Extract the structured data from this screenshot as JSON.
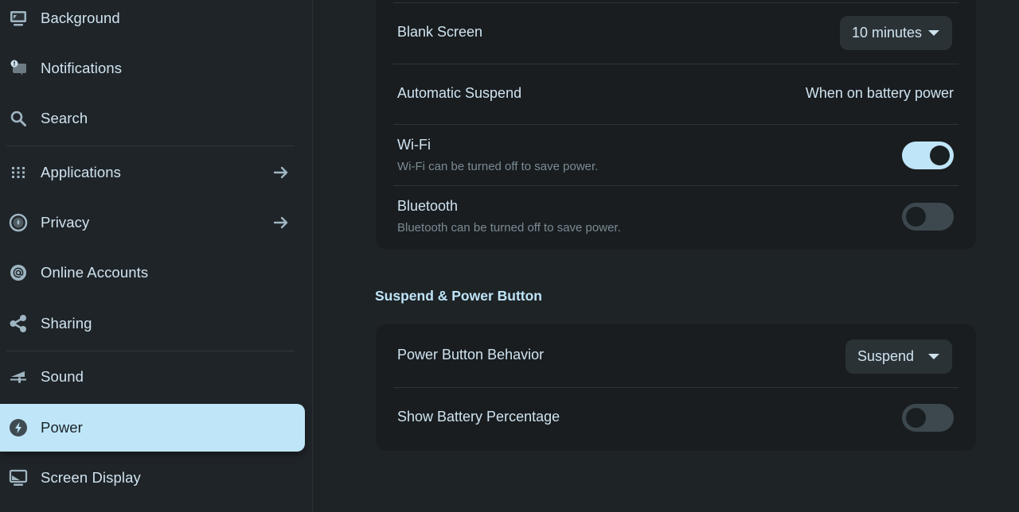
{
  "sidebar": {
    "items": [
      {
        "label": "Background",
        "icon": "desktop-monitor-icon",
        "active": false
      },
      {
        "label": "Notifications",
        "icon": "notification-bell-icon",
        "active": false
      },
      {
        "label": "Search",
        "icon": "search-icon",
        "active": false
      },
      {
        "label": "Applications",
        "icon": "apps-grid-icon",
        "active": false,
        "has_arrow": true
      },
      {
        "label": "Privacy",
        "icon": "privacy-icon",
        "active": false,
        "has_arrow": true
      },
      {
        "label": "Online Accounts",
        "icon": "at-sign-icon",
        "active": false
      },
      {
        "label": "Sharing",
        "icon": "share-icon",
        "active": false
      },
      {
        "label": "Sound",
        "icon": "sound-icon",
        "active": false
      },
      {
        "label": "Power",
        "icon": "power-bolt-icon",
        "active": true
      },
      {
        "label": "Screen Display",
        "icon": "display-icon",
        "active": false
      }
    ]
  },
  "power_saving": {
    "blank_screen": {
      "label": "Blank Screen",
      "value": "10 minutes"
    },
    "automatic_suspend": {
      "label": "Automatic Suspend",
      "value": "When on battery power"
    },
    "wifi": {
      "label": "Wi-Fi",
      "subtitle": "Wi-Fi can be turned off to save power.",
      "enabled": true
    },
    "bluetooth": {
      "label": "Bluetooth",
      "subtitle": "Bluetooth can be turned off to save power.",
      "enabled": false
    }
  },
  "suspend_section": {
    "heading": "Suspend & Power Button",
    "power_button_behavior": {
      "label": "Power Button Behavior",
      "value": "Suspend"
    },
    "show_battery_percentage": {
      "label": "Show Battery Percentage",
      "enabled": false
    }
  },
  "colors": {
    "accent": "#bfe5f8",
    "background": "#1f2427",
    "card": "#191d20",
    "text": "#cfe3ef",
    "subtext": "#7b8b94"
  }
}
